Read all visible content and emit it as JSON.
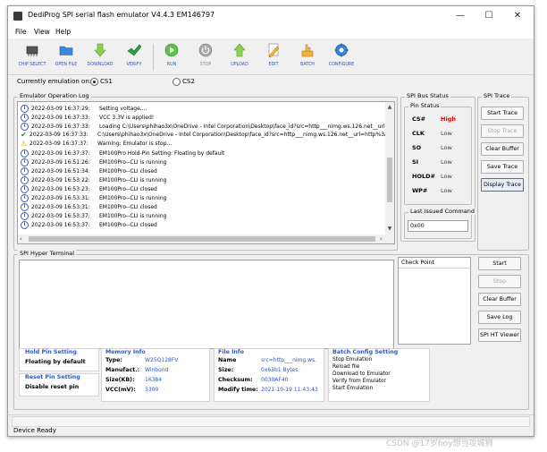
{
  "window": {
    "title": "DediProg SPI serial flash emulator V4.4.3  EM146797",
    "controls": {
      "minimize": "—",
      "maximize": "☐",
      "close": "✕"
    }
  },
  "menu": [
    "File",
    "View",
    "Help"
  ],
  "toolbar": [
    {
      "label": "CHIP SELECT",
      "icon": "chip-icon"
    },
    {
      "label": "OPEN FILE",
      "icon": "folder-icon"
    },
    {
      "label": "DOWNLOAD",
      "icon": "download-arrow-icon"
    },
    {
      "label": "VERIFY",
      "icon": "checkmark-icon"
    },
    {
      "label": "RUN",
      "icon": "play-icon"
    },
    {
      "label": "STOP",
      "icon": "power-icon"
    },
    {
      "label": "UPLOAD",
      "icon": "upload-arrow-icon"
    },
    {
      "label": "EDIT",
      "icon": "edit-pencil-icon"
    },
    {
      "label": "BATCH",
      "icon": "batch-hand-icon"
    },
    {
      "label": "CONFIGURE",
      "icon": "gear-icon"
    }
  ],
  "emulation": {
    "label": "Currently emulation on:",
    "options": [
      "CS1",
      "CS2"
    ],
    "selected": "CS1"
  },
  "log": {
    "title": "Emulator Operation Log",
    "rows": [
      {
        "type": "info",
        "time": "2022-03-09 16:37:29:",
        "msg": "Setting voltage...."
      },
      {
        "type": "info",
        "time": "2022-03-09 16:37:33:",
        "msg": "VCC 3.3V is applied!"
      },
      {
        "type": "info",
        "time": "2022-03-09 16:37:33:",
        "msg": "Loading C:\\Users\\phihao3x\\OneDrive - Intel Corporation\\Desktop\\face_id?src=http___nimg.ws.126.net__url=h"
      },
      {
        "type": "check",
        "time": "2022-03-09 16:37:33:",
        "msg": "C:\\Users\\phihao3x\\OneDrive - Intel Corporation\\Desktop\\face_id?src=http___nimg.ws.126.net__url=http%3A"
      },
      {
        "type": "warn",
        "time": "2022-03-09 16:37:37:",
        "msg": "Warning: Emulator is stop..."
      },
      {
        "type": "info",
        "time": "2022-03-09 16:37:37:",
        "msg": "EM100Pro Hold-Pin Setting: Floating by default"
      },
      {
        "type": "info",
        "time": "2022-03-09 16:51:26:",
        "msg": "EM100Pro--CLI is running"
      },
      {
        "type": "info",
        "time": "2022-03-09 16:51:34:",
        "msg": "EM100Pro--CLI closed"
      },
      {
        "type": "info",
        "time": "2022-03-09 16:53:22:",
        "msg": "EM100Pro--CLI is running"
      },
      {
        "type": "info",
        "time": "2022-03-09 16:53:23:",
        "msg": "EM100Pro--CLI closed"
      },
      {
        "type": "info",
        "time": "2022-03-09 16:53:31:",
        "msg": "EM100Pro--CLI is running"
      },
      {
        "type": "info",
        "time": "2022-03-09 16:53:31:",
        "msg": "EM100Pro--CLI closed"
      },
      {
        "type": "info",
        "time": "2022-03-09 16:53:37:",
        "msg": "EM100Pro--CLI is running"
      },
      {
        "type": "info",
        "time": "2022-03-09 16:53:37:",
        "msg": "EM100Pro--CLI closed"
      }
    ]
  },
  "spi_bus": {
    "title": "SPI Bus Status",
    "pin_title": "Pin Status",
    "pins": [
      {
        "name": "CS#",
        "value": "High",
        "color": "#e00000"
      },
      {
        "name": "CLK",
        "value": "Low",
        "color": "#444444"
      },
      {
        "name": "SO",
        "value": "Low",
        "color": "#444444"
      },
      {
        "name": "SI",
        "value": "Low",
        "color": "#444444"
      },
      {
        "name": "HOLD#",
        "value": "Low",
        "color": "#444444"
      },
      {
        "name": "WP#",
        "value": "Low",
        "color": "#444444"
      }
    ],
    "last_cmd_title": "Last Issued Command",
    "last_cmd_value": "0x00"
  },
  "spi_trace": {
    "title": "SPI Trace",
    "buttons": [
      "Start Trace",
      "Stop Trace",
      "Clear Buffer",
      "Save Trace",
      "Display Trace"
    ]
  },
  "hyper_terminal": {
    "title": "SPI Hyper Terminal",
    "checkpoint_title": "Check Point",
    "buttons": [
      "Start",
      "Stop",
      "Clear Buffer",
      "Save Log",
      "SPI HT Viewer"
    ]
  },
  "bottom": {
    "hold_pin": {
      "title": "Hold Pin Setting",
      "value": "Floating by default"
    },
    "reset_pin": {
      "title": "Reset Pin Setting",
      "value": "Disable reset pin"
    },
    "memory": {
      "title": "Memory Info",
      "rows": [
        {
          "label": "Type:",
          "value": "W25Q128FV"
        },
        {
          "label": "Manufact.:",
          "value": "Winbond"
        },
        {
          "label": "Size(KB):",
          "value": "16384"
        },
        {
          "label": "VCC(mV):",
          "value": "3300"
        }
      ]
    },
    "file": {
      "title": "File Info",
      "rows": [
        {
          "label": "Name",
          "value": "src=http___nimg.ws."
        },
        {
          "label": "Size:",
          "value": "0x63b1 Bytes"
        },
        {
          "label": "Checksum:",
          "value": "0030AF40"
        },
        {
          "label": "Modify time:",
          "value": "2021-10-19 11:43:43"
        }
      ]
    },
    "batch": {
      "title": "Batch Config Setting",
      "items": [
        "Stop Emulation",
        "Reload file",
        "Download to Emulator",
        "Verify from Emulator",
        "Start Emulation"
      ]
    }
  },
  "status": "Device Ready",
  "watermark": "CSDN @17岁boy想当攻城狮"
}
